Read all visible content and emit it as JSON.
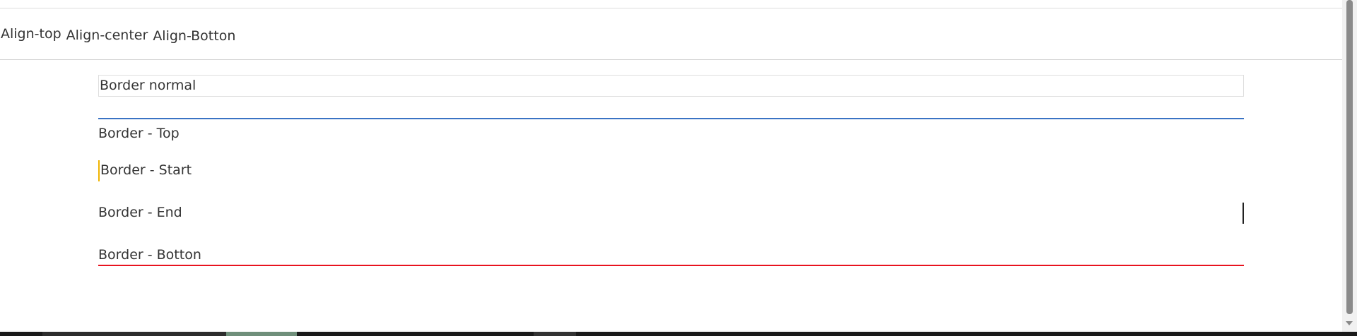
{
  "alignment_row": {
    "items": [
      {
        "label": "Align-top"
      },
      {
        "label": "Align-center"
      },
      {
        "label": "Align-Botton"
      }
    ]
  },
  "border_boxes": {
    "normal": {
      "label": "Border normal"
    },
    "top": {
      "label": "Border - Top",
      "color": "#3a73c4"
    },
    "start": {
      "label": "Border - Start",
      "color": "#f0b400"
    },
    "end": {
      "label": "Border - End",
      "color": "#222222"
    },
    "bottom": {
      "label": "Border - Botton",
      "color": "#e8131f"
    }
  }
}
